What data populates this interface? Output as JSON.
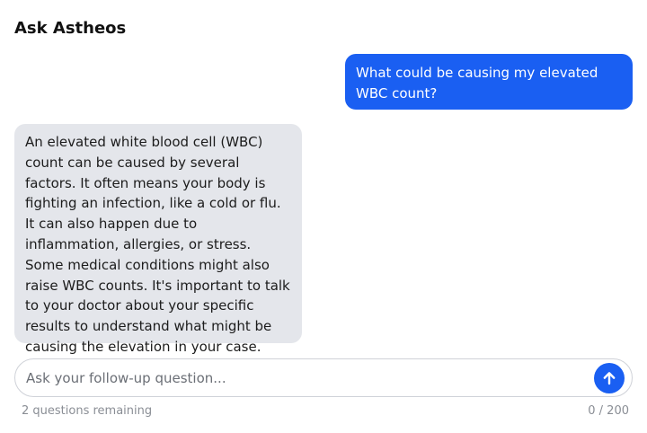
{
  "header": {
    "title": "Ask Astheos"
  },
  "conversation": {
    "user_message": "What could be causing my elevated WBC count?",
    "assistant_message": "An elevated white blood cell (WBC) count can be caused by several factors. It often means your body is fighting an infection, like a cold or flu. It can also happen due to inflammation, allergies, or stress. Some medical conditions might also raise WBC counts. It's important to talk to your doctor about your specific results to understand what might be causing the elevation in your case."
  },
  "composer": {
    "placeholder": "Ask your follow-up question...",
    "value": "",
    "send_icon": "arrow-up-icon",
    "remaining_text": "2 questions remaining",
    "char_counter": "0 / 200"
  },
  "colors": {
    "accent": "#1a5ff2",
    "assistant_bubble": "#e4e6eb",
    "muted_text": "#8a8e95"
  }
}
